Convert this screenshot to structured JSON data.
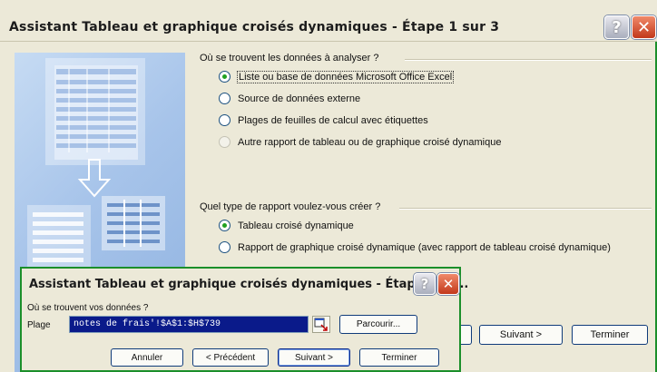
{
  "main_dialog": {
    "title": "Assistant Tableau et graphique croisés dynamiques - Étape 1 sur 3",
    "help_label": "?",
    "close_label": "✕",
    "source_question": "Où se trouvent les données à analyser ?",
    "source_options": [
      {
        "label": "Liste ou base de données Microsoft Office Excel",
        "selected": true,
        "enabled": true
      },
      {
        "label": "Source de données externe",
        "selected": false,
        "enabled": true
      },
      {
        "label": "Plages de feuilles de calcul avec étiquettes",
        "selected": false,
        "enabled": true
      },
      {
        "label": "Autre rapport de tableau ou de graphique croisé dynamique",
        "selected": false,
        "enabled": false
      }
    ],
    "report_question": "Quel type de rapport voulez-vous créer ?",
    "report_options": [
      {
        "label": "Tableau croisé dynamique",
        "selected": true,
        "enabled": true
      },
      {
        "label": "Rapport de graphique croisé dynamique (avec rapport de tableau croisé dynamique)",
        "selected": false,
        "enabled": true
      }
    ],
    "buttons": {
      "next": "Suivant >",
      "finish": "Terminer"
    }
  },
  "step2_dialog": {
    "title": "Assistant Tableau et graphique croisés dynamiques - Étape 2 su...",
    "help_label": "?",
    "close_label": "✕",
    "question": "Où se trouvent vos données ?",
    "range_label": "Plage",
    "range_value": "notes de frais'!$A$1:$H$739",
    "browse_label": "Parcourir...",
    "buttons": {
      "cancel": "Annuler",
      "previous": "< Précédent",
      "next": "Suivant >",
      "finish": "Terminer"
    }
  },
  "colors": {
    "accent_green": "#1b8f2a",
    "dialog_bg": "#ece9d8",
    "selection_blue": "#0a1a8a"
  }
}
